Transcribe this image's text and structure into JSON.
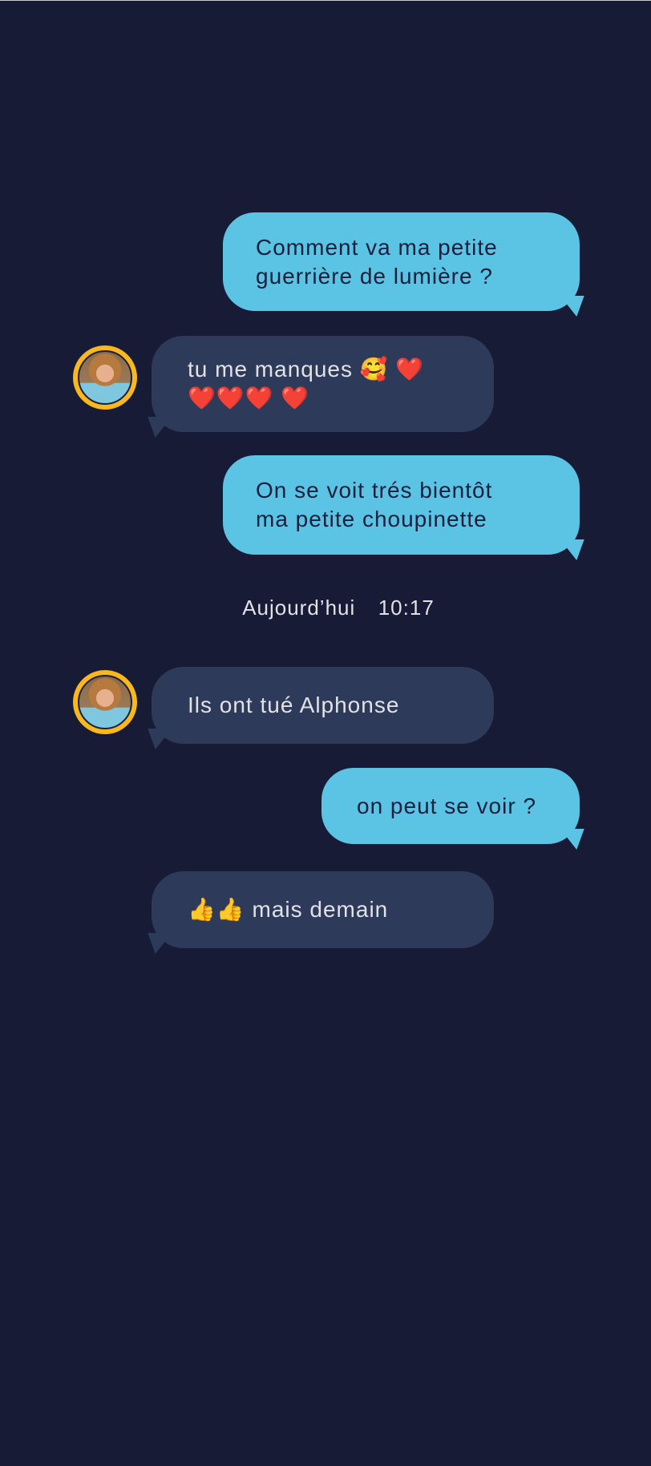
{
  "colors": {
    "background": "#181b36",
    "outgoing_bubble": "#5bc3e4",
    "incoming_bubble": "#2e3a5a",
    "avatar_ring": "#fbb81c",
    "heart": "#e5321c"
  },
  "messages": [
    {
      "direction": "outgoing",
      "text": "Comment va ma petite\nguerrière de lumière ?"
    },
    {
      "direction": "incoming",
      "text": "tu me manques 🥰 ❤️\n❤️❤️❤️ ❤️",
      "avatar": "contact-avatar"
    },
    {
      "direction": "outgoing",
      "text": "On se voit trés bientôt\nma petite choupinette"
    },
    {
      "direction": "incoming",
      "text": "Ils ont tué Alphonse",
      "avatar": "contact-avatar"
    },
    {
      "direction": "outgoing",
      "text": "on peut se voir ?"
    },
    {
      "direction": "incoming",
      "text": "👍👍 mais demain"
    }
  ],
  "timestamp": "Aujourd’hui  10:17"
}
